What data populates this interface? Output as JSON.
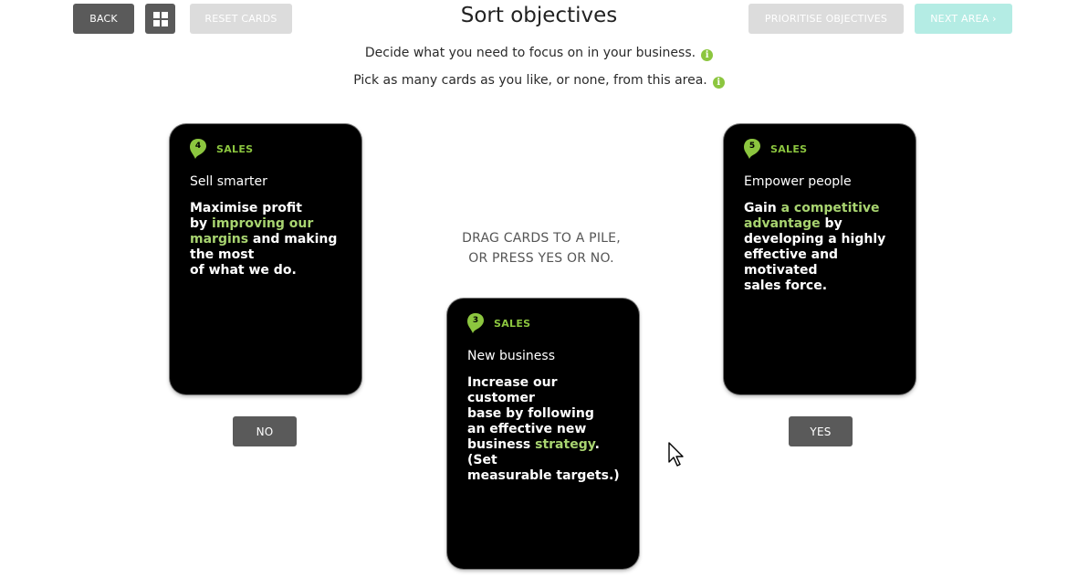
{
  "toolbar": {
    "back_label": "BACK",
    "reset_label": "RESET CARDS",
    "prioritise_label": "PRIORITISE OBJECTIVES",
    "next_label": "NEXT AREA ›",
    "grid_icon": "grid-icon"
  },
  "header": {
    "title": "Sort objectives",
    "instruction_1": "Decide what you need to focus on in your business.",
    "instruction_2": "Pick as many cards as you like, or none, from this area.",
    "info_icon_glyph": "i"
  },
  "center": {
    "drag_line_1": "DRAG CARDS TO A PILE,",
    "drag_line_2": "OR PRESS YES OR NO."
  },
  "piles": {
    "no_label": "NO",
    "yes_label": "YES"
  },
  "cards": {
    "left": {
      "number": "4",
      "category": "SALES",
      "title": "Sell smarter",
      "body": [
        {
          "text": "Maximise profit\nby ",
          "highlight": false
        },
        {
          "text": "improving our\nmargins",
          "highlight": true
        },
        {
          "text": " and making\nthe most\nof what we do.",
          "highlight": false
        }
      ]
    },
    "center": {
      "number": "3",
      "category": "SALES",
      "title": "New business",
      "body": [
        {
          "text": "Increase our customer\nbase by following\nan effective new\nbusiness ",
          "highlight": false
        },
        {
          "text": "strategy",
          "highlight": true
        },
        {
          "text": ". (Set\nmeasurable targets.)",
          "highlight": false
        }
      ]
    },
    "right": {
      "number": "5",
      "category": "SALES",
      "title": "Empower people",
      "body": [
        {
          "text": "Gain ",
          "highlight": false
        },
        {
          "text": "a competitive\nadvantage",
          "highlight": true
        },
        {
          "text": " by\ndeveloping a highly\neffective and motivated\nsales force.",
          "highlight": false
        }
      ]
    }
  },
  "colors": {
    "accent_green": "#8cc63f",
    "highlight_green": "#a8d470",
    "button_dark": "#5a5a5a",
    "button_disabled": "#dcdcdc",
    "button_teal": "#b4ece4",
    "card_bg": "#000000"
  }
}
